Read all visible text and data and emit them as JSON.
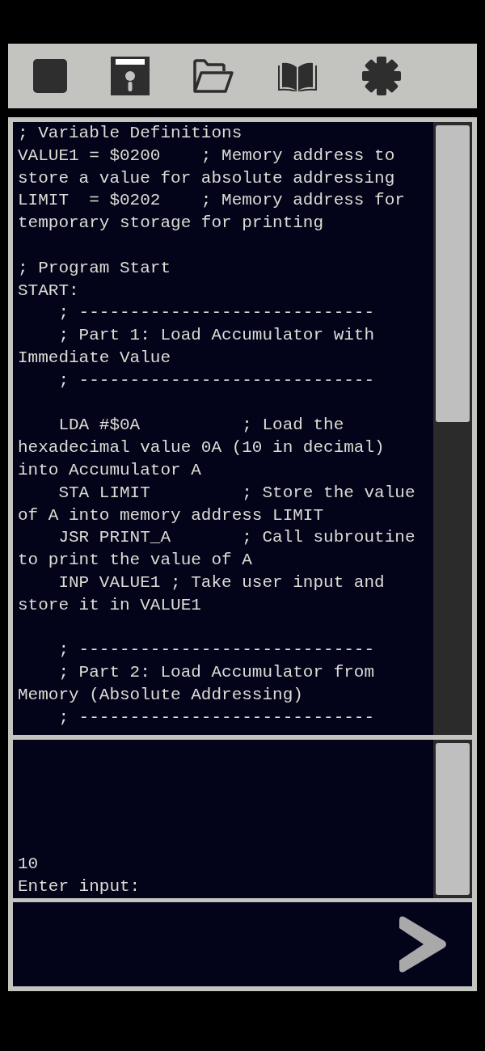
{
  "editor": {
    "lines": [
      {
        "kind": "code",
        "text": "; Variable Definitions"
      },
      {
        "kind": "code",
        "text": "VALUE1 = $0200    ; Memory address to"
      },
      {
        "kind": "code",
        "text": "store a value for absolute addressing"
      },
      {
        "kind": "code",
        "text": "LIMIT  = $0202    ; Memory address for"
      },
      {
        "kind": "code",
        "text": "temporary storage for printing"
      },
      {
        "kind": "blank"
      },
      {
        "kind": "code",
        "text": "; Program Start"
      },
      {
        "kind": "code",
        "text": "START:"
      },
      {
        "kind": "code",
        "text": "    ; -----------------------------"
      },
      {
        "kind": "code",
        "text": "    ; Part 1: Load Accumulator with"
      },
      {
        "kind": "code",
        "text": "Immediate Value"
      },
      {
        "kind": "code",
        "text": "    ; -----------------------------"
      },
      {
        "kind": "blank"
      },
      {
        "kind": "code",
        "text": "    LDA #$0A          ; Load the"
      },
      {
        "kind": "code",
        "text": "hexadecimal value 0A (10 in decimal)"
      },
      {
        "kind": "code",
        "text": "into Accumulator A"
      },
      {
        "kind": "code",
        "text": "    STA LIMIT         ; Store the value"
      },
      {
        "kind": "code",
        "text": "of A into memory address LIMIT"
      },
      {
        "kind": "code",
        "text": "    JSR PRINT_A       ; Call subroutine"
      },
      {
        "kind": "code",
        "text": "to print the value of A"
      },
      {
        "kind": "code",
        "text": "    INP VALUE1 ; Take user input and"
      },
      {
        "kind": "code",
        "text": "store it in VALUE1"
      },
      {
        "kind": "blank"
      },
      {
        "kind": "code",
        "text": "    ; -----------------------------"
      },
      {
        "kind": "code",
        "text": "    ; Part 2: Load Accumulator from"
      },
      {
        "kind": "code",
        "text": "Memory (Absolute Addressing)"
      },
      {
        "kind": "code",
        "text": "    ; -----------------------------"
      }
    ]
  },
  "console": {
    "lines": [
      "10",
      "Enter input:"
    ]
  }
}
